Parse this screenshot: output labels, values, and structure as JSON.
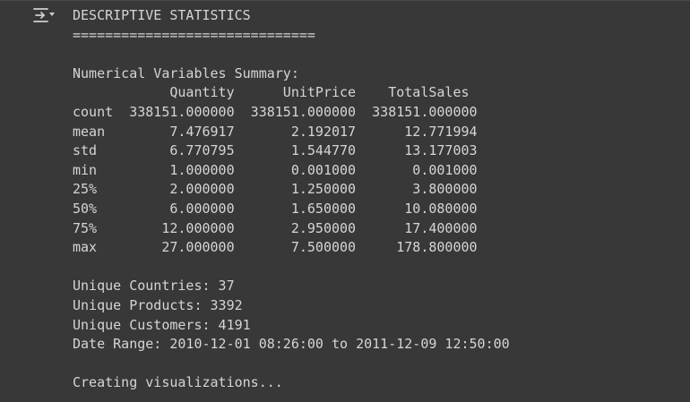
{
  "output_toggle_icon": "collapse-output-icon",
  "output": {
    "lines": [
      "DESCRIPTIVE STATISTICS",
      "==============================",
      "",
      "Numerical Variables Summary:",
      "            Quantity      UnitPrice    TotalSales",
      "count  338151.000000  338151.000000  338151.000000",
      "mean        7.476917       2.192017      12.771994",
      "std         6.770795       1.544770      13.177003",
      "min         1.000000       0.001000       0.001000",
      "25%         2.000000       1.250000       3.800000",
      "50%         6.000000       1.650000      10.080000",
      "75%        12.000000       2.950000      17.400000",
      "max        27.000000       7.500000     178.800000",
      "",
      "Unique Countries: 37",
      "Unique Products: 3392",
      "Unique Customers: 4191",
      "Date Range: 2010-12-01 08:26:00 to 2011-12-09 12:50:00",
      "",
      "Creating visualizations..."
    ]
  }
}
